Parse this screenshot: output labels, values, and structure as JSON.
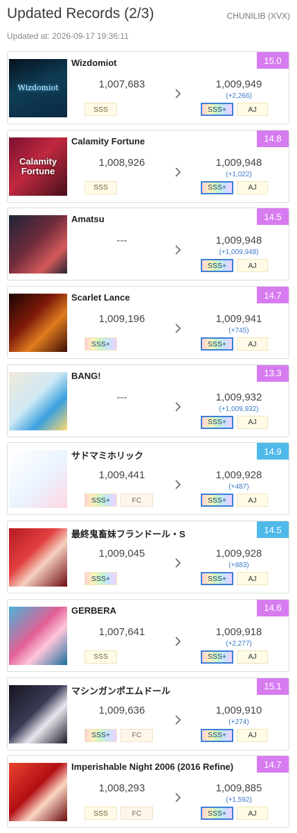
{
  "header": {
    "title": "Updated Records (2/3)",
    "source": "CHUNILIB (XVX)",
    "updated_at": "Updated at: 2026-09-17 19:36:11"
  },
  "colors": {
    "level_master": "#d77cf0",
    "level_expert": "#4fb9e9",
    "diff_text": "#3b78c7",
    "rank_badge_border": "#3b7fd8"
  },
  "records": [
    {
      "title": "Wizdomiot",
      "jacket_text": "Wizdomiot",
      "level": "15.0",
      "difficulty": "master",
      "old_score": "1,007,683",
      "old_badges": [
        "SSS"
      ],
      "new_score": "1,009,949",
      "diff": "(+2,266)",
      "new_badges": [
        "SSS+",
        "AJ"
      ]
    },
    {
      "title": "Calamity Fortune",
      "jacket_text": "Calamity Fortune",
      "level": "14.8",
      "difficulty": "master",
      "old_score": "1,008,926",
      "old_badges": [
        "SSS"
      ],
      "new_score": "1,009,948",
      "diff": "(+1,022)",
      "new_badges": [
        "SSS+",
        "AJ"
      ]
    },
    {
      "title": "Amatsu",
      "jacket_text": "",
      "level": "14.5",
      "difficulty": "master",
      "old_score": "---",
      "old_badges": [],
      "new_score": "1,009,948",
      "diff": "(+1,009,948)",
      "new_badges": [
        "SSS+",
        "AJ"
      ]
    },
    {
      "title": "Scarlet Lance",
      "jacket_text": "",
      "level": "14.7",
      "difficulty": "master",
      "old_score": "1,009,196",
      "old_badges": [
        "SSS+"
      ],
      "new_score": "1,009,941",
      "diff": "(+745)",
      "new_badges": [
        "SSS+",
        "AJ"
      ]
    },
    {
      "title": "BANG!",
      "jacket_text": "",
      "level": "13.3",
      "difficulty": "master",
      "old_score": "---",
      "old_badges": [],
      "new_score": "1,009,932",
      "diff": "(+1,009,932)",
      "new_badges": [
        "SSS+",
        "AJ"
      ]
    },
    {
      "title": "サドマミホリック",
      "jacket_text": "",
      "level": "14.9",
      "difficulty": "expert",
      "old_score": "1,009,441",
      "old_badges": [
        "SSS+",
        "FC"
      ],
      "new_score": "1,009,928",
      "diff": "(+487)",
      "new_badges": [
        "SSS+",
        "AJ"
      ]
    },
    {
      "title": "最終鬼畜妹フランドール・S",
      "jacket_text": "",
      "level": "14.5",
      "difficulty": "expert",
      "old_score": "1,009,045",
      "old_badges": [
        "SSS+"
      ],
      "new_score": "1,009,928",
      "diff": "(+883)",
      "new_badges": [
        "SSS+",
        "AJ"
      ]
    },
    {
      "title": "GERBERA",
      "jacket_text": "",
      "level": "14.6",
      "difficulty": "master",
      "old_score": "1,007,641",
      "old_badges": [
        "SSS"
      ],
      "new_score": "1,009,918",
      "diff": "(+2,277)",
      "new_badges": [
        "SSS+",
        "AJ"
      ]
    },
    {
      "title": "マシンガンポエムドール",
      "jacket_text": "",
      "level": "15.1",
      "difficulty": "master",
      "old_score": "1,009,636",
      "old_badges": [
        "SSS+",
        "FC"
      ],
      "new_score": "1,009,910",
      "diff": "(+274)",
      "new_badges": [
        "SSS+",
        "AJ"
      ]
    },
    {
      "title": "Imperishable Night 2006 (2016 Refine)",
      "jacket_text": "",
      "level": "14.7",
      "difficulty": "master",
      "old_score": "1,008,293",
      "old_badges": [
        "SSS",
        "FC"
      ],
      "new_score": "1,009,885",
      "diff": "(+1,592)",
      "new_badges": [
        "SSS+",
        "AJ"
      ]
    }
  ]
}
